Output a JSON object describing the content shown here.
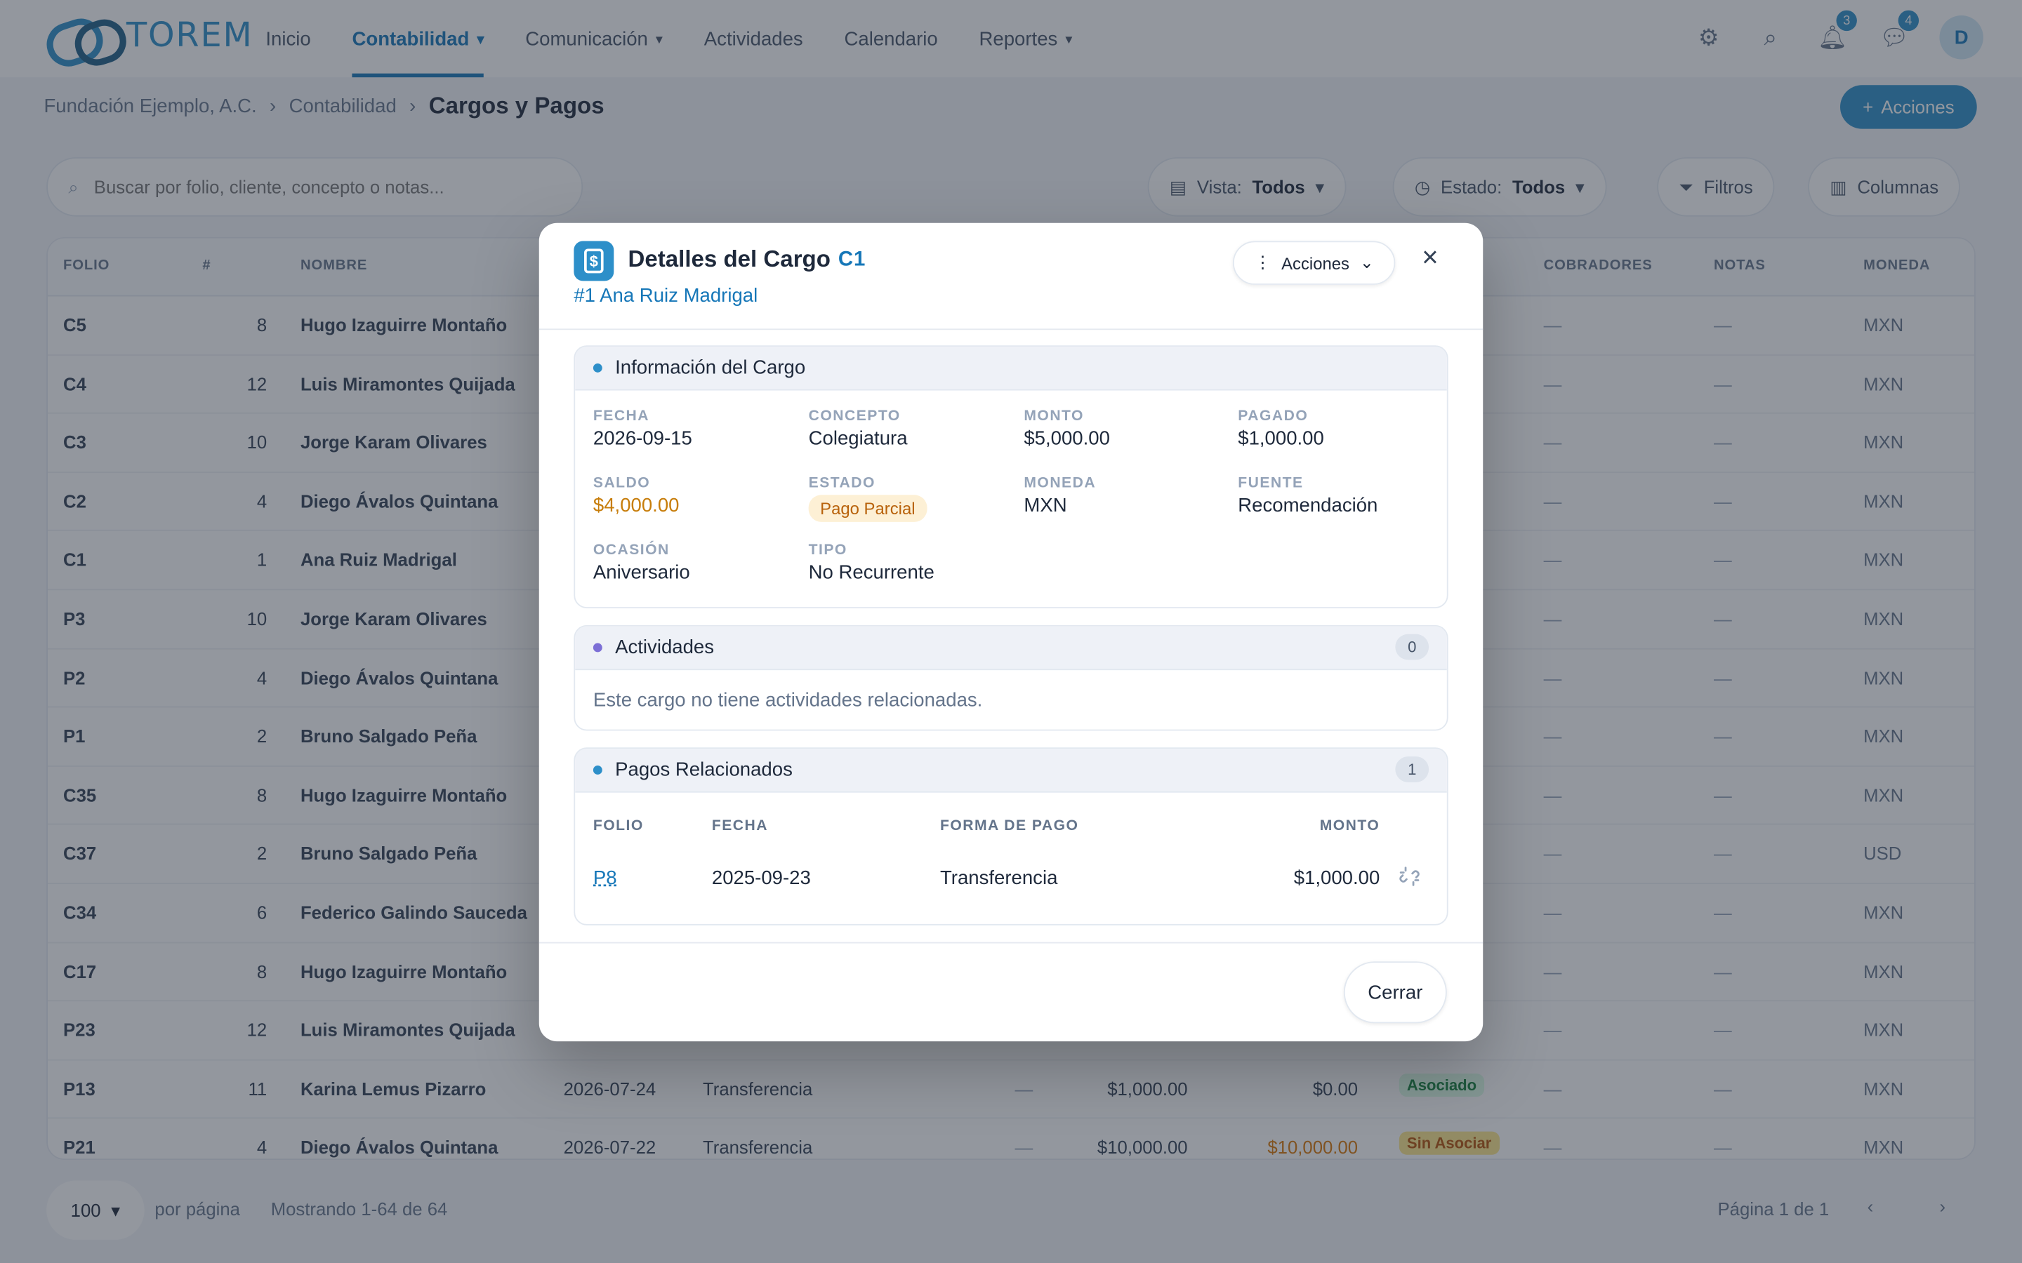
{
  "brand": {
    "name": "TOREM"
  },
  "nav": {
    "items": [
      {
        "label": "Inicio",
        "has_menu": false,
        "active": false
      },
      {
        "label": "Contabilidad",
        "has_menu": true,
        "active": true
      },
      {
        "label": "Comunicación",
        "has_menu": true,
        "active": false
      },
      {
        "label": "Actividades",
        "has_menu": false,
        "active": false
      },
      {
        "label": "Calendario",
        "has_menu": false,
        "active": false
      },
      {
        "label": "Reportes",
        "has_menu": true,
        "active": false
      }
    ],
    "notifications_count": "3",
    "messages_count": "4",
    "avatar_initial": "D"
  },
  "breadcrumb": {
    "org": "Fundación Ejemplo, A.C.",
    "section": "Contabilidad",
    "current": "Cargos y Pagos"
  },
  "page_actions_label": "Acciones",
  "toolbar": {
    "search_placeholder": "Buscar por folio, cliente, concepto o notas...",
    "view_label": "Vista:",
    "view_value": "Todos",
    "status_label": "Estado:",
    "status_value": "Todos",
    "filters_label": "Filtros",
    "columns_label": "Columnas"
  },
  "table": {
    "headers": {
      "folio": "FOLIO",
      "num": "#",
      "name": "NOMBRE",
      "cobradores": "COBRADORES",
      "notas": "NOTAS",
      "moneda": "MONEDA"
    },
    "rows": [
      {
        "folio": "C5",
        "num": "8",
        "name": "Hugo Izaguirre Montaño",
        "date": "",
        "forma": "",
        "monto": "",
        "saldo": "",
        "badge": "",
        "cob": "—",
        "notas": "—",
        "moneda": "MXN"
      },
      {
        "folio": "C4",
        "num": "12",
        "name": "Luis Miramontes Quijada",
        "date": "",
        "forma": "",
        "monto": "",
        "saldo": "",
        "badge": "",
        "cob": "—",
        "notas": "—",
        "moneda": "MXN"
      },
      {
        "folio": "C3",
        "num": "10",
        "name": "Jorge Karam Olivares",
        "date": "",
        "forma": "",
        "monto": "",
        "saldo": "",
        "badge": "",
        "cob": "—",
        "notas": "—",
        "moneda": "MXN"
      },
      {
        "folio": "C2",
        "num": "4",
        "name": "Diego Ávalos Quintana",
        "date": "",
        "forma": "",
        "monto": "",
        "saldo": "",
        "badge": "",
        "cob": "—",
        "notas": "—",
        "moneda": "MXN"
      },
      {
        "folio": "C1",
        "num": "1",
        "name": "Ana Ruiz Madrigal",
        "date": "",
        "forma": "",
        "monto": "",
        "saldo": "",
        "badge": "",
        "cob": "—",
        "notas": "—",
        "moneda": "MXN"
      },
      {
        "folio": "P3",
        "num": "10",
        "name": "Jorge Karam Olivares",
        "date": "",
        "forma": "",
        "monto": "",
        "saldo": "",
        "badge": "",
        "cob": "—",
        "notas": "—",
        "moneda": "MXN"
      },
      {
        "folio": "P2",
        "num": "4",
        "name": "Diego Ávalos Quintana",
        "date": "",
        "forma": "",
        "monto": "",
        "saldo": "",
        "badge": "",
        "cob": "—",
        "notas": "—",
        "moneda": "MXN"
      },
      {
        "folio": "P1",
        "num": "2",
        "name": "Bruno Salgado Peña",
        "date": "",
        "forma": "",
        "monto": "",
        "saldo": "",
        "badge": "",
        "cob": "—",
        "notas": "—",
        "moneda": "MXN"
      },
      {
        "folio": "C35",
        "num": "8",
        "name": "Hugo Izaguirre Montaño",
        "date": "",
        "forma": "",
        "monto": "",
        "saldo": "",
        "badge": "",
        "cob": "—",
        "notas": "—",
        "moneda": "MXN"
      },
      {
        "folio": "C37",
        "num": "2",
        "name": "Bruno Salgado Peña",
        "date": "",
        "forma": "",
        "monto": "",
        "saldo": "",
        "badge": "",
        "cob": "—",
        "notas": "—",
        "moneda": "USD"
      },
      {
        "folio": "C34",
        "num": "6",
        "name": "Federico Galindo Sauceda",
        "date": "",
        "forma": "",
        "monto": "",
        "saldo": "",
        "badge": "",
        "cob": "—",
        "notas": "—",
        "moneda": "MXN"
      },
      {
        "folio": "C17",
        "num": "8",
        "name": "Hugo Izaguirre Montaño",
        "date": "",
        "forma": "",
        "monto": "",
        "saldo": "",
        "badge": "",
        "cob": "—",
        "notas": "—",
        "moneda": "MXN"
      },
      {
        "folio": "P23",
        "num": "12",
        "name": "Luis Miramontes Quijada",
        "date": "",
        "forma": "",
        "monto": "",
        "saldo": "",
        "badge": "",
        "cob": "—",
        "notas": "—",
        "moneda": "MXN"
      },
      {
        "folio": "P13",
        "num": "11",
        "name": "Karina Lemus Pizarro",
        "date": "2026-07-24",
        "forma": "Transferencia",
        "dash": "—",
        "monto": "$1,000.00",
        "saldo": "$0.00",
        "badge": "Asociado",
        "cob": "—",
        "notas": "—",
        "moneda": "MXN"
      },
      {
        "folio": "P21",
        "num": "4",
        "name": "Diego Ávalos Quintana",
        "date": "2026-07-22",
        "forma": "Transferencia",
        "dash": "—",
        "monto": "$10,000.00",
        "saldo": "$10,000.00",
        "badge": "Sin Asociar",
        "cob": "—",
        "notas": "—",
        "moneda": "MXN"
      }
    ]
  },
  "pager": {
    "page_size": "100",
    "per_page_label": "por página",
    "showing": "Mostrando 1-64 de 64",
    "page_info": "Página 1 de 1"
  },
  "modal": {
    "title": "Detalles del Cargo",
    "folio": "C1",
    "subtitle": "#1 Ana Ruiz Madrigal",
    "actions_label": "Acciones",
    "info": {
      "title": "Información del Cargo",
      "fields": {
        "fecha": {
          "label": "FECHA",
          "value": "2026-09-15"
        },
        "concepto": {
          "label": "CONCEPTO",
          "value": "Colegiatura"
        },
        "monto": {
          "label": "MONTO",
          "value": "$5,000.00"
        },
        "pagado": {
          "label": "PAGADO",
          "value": "$1,000.00"
        },
        "saldo": {
          "label": "SALDO",
          "value": "$4,000.00"
        },
        "estado": {
          "label": "ESTADO",
          "value": "Pago Parcial"
        },
        "moneda": {
          "label": "MONEDA",
          "value": "MXN"
        },
        "fuente": {
          "label": "FUENTE",
          "value": "Recomendación"
        },
        "ocasion": {
          "label": "OCASIÓN",
          "value": "Aniversario"
        },
        "tipo": {
          "label": "TIPO",
          "value": "No Recurrente"
        }
      }
    },
    "activities": {
      "title": "Actividades",
      "count": "0",
      "empty": "Este cargo no tiene actividades relacionadas."
    },
    "payments": {
      "title": "Pagos Relacionados",
      "count": "1",
      "headers": {
        "folio": "FOLIO",
        "fecha": "FECHA",
        "forma": "FORMA DE PAGO",
        "monto": "MONTO"
      },
      "rows": [
        {
          "folio": "P8",
          "fecha": "2025-09-23",
          "forma": "Transferencia",
          "monto": "$1,000.00"
        }
      ]
    },
    "close_label": "Cerrar"
  },
  "colors": {
    "accent": "#1677b8",
    "brand": "#2d8fc9",
    "warning": "#c77d0a",
    "dot_info": "#2d8fc9",
    "dot_activity": "#7c6fd6"
  }
}
